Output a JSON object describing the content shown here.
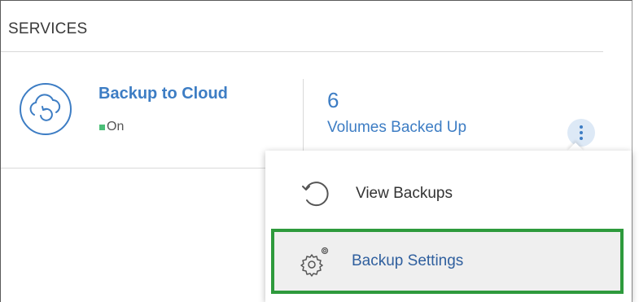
{
  "section": {
    "title": "SERVICES"
  },
  "service": {
    "name": "Backup to Cloud",
    "status_text": "On",
    "icon": "cloud-refresh-icon"
  },
  "metric": {
    "value": "6",
    "label": "Volumes Backed Up"
  },
  "menu": {
    "items": [
      {
        "label": "View Backups",
        "icon": "history-icon"
      },
      {
        "label": "Backup Settings",
        "icon": "gear-icon",
        "highlighted": true
      }
    ]
  },
  "colors": {
    "accent": "#3d7dc4",
    "status_on": "#4cbf78",
    "highlight_border": "#2e9a3c"
  }
}
